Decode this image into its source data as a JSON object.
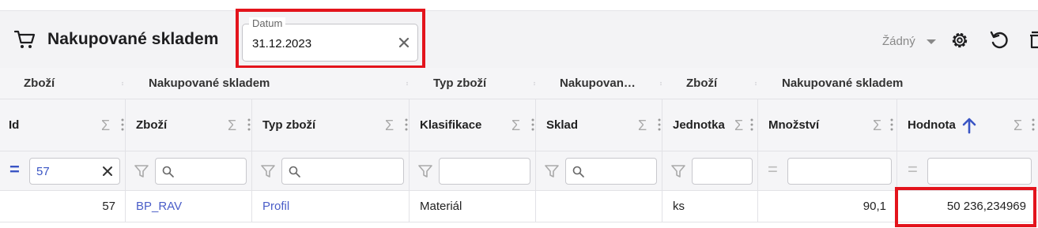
{
  "header": {
    "title": "Nakupované skladem",
    "date_filter": {
      "label": "Datum",
      "value": "31.12.2023"
    },
    "view_select": "Žádný",
    "icons": [
      "cart-icon",
      "gear-icon",
      "undo-icon",
      "delete-icon"
    ]
  },
  "group_headers": [
    "Zboží",
    "Nakupované skladem",
    "Typ zboží",
    "Nakupovan…",
    "Zboží",
    "Nakupované skladem"
  ],
  "columns": [
    "Id",
    "Zboží",
    "Typ zboží",
    "Klasifikace",
    "Sklad",
    "Jednotka",
    "Množství",
    "Hodnota"
  ],
  "sort": {
    "column": "Hodnota",
    "direction": "asc"
  },
  "filters": {
    "id": "57"
  },
  "rows": [
    {
      "id": "57",
      "zbozi": "BP_RAV",
      "typ": "Profil",
      "klasifikace": "Materiál",
      "sklad": "",
      "jednotka": "ks",
      "mnozstvi": "90,1",
      "hodnota": "50 236,234969"
    }
  ],
  "colors": {
    "accent": "#3a55c4",
    "highlight": "#e3141c",
    "link": "#4a5dc8"
  }
}
